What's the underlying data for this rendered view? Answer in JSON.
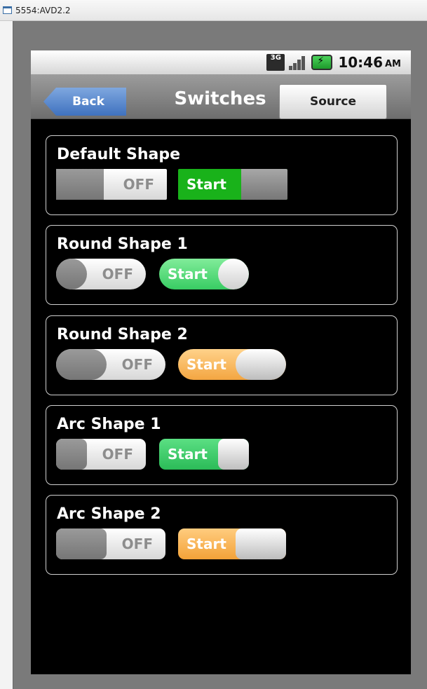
{
  "window": {
    "title": "5554:AVD2.2"
  },
  "status_bar": {
    "network": "3G",
    "time": "10:46",
    "ampm": "AM"
  },
  "nav": {
    "back_label": "Back",
    "title": "Switches",
    "source_label": "Source"
  },
  "panels": [
    {
      "title": "Default Shape",
      "off_label": "OFF",
      "on_label": "Start"
    },
    {
      "title": "Round Shape 1",
      "off_label": "OFF",
      "on_label": "Start"
    },
    {
      "title": "Round Shape 2",
      "off_label": "OFF",
      "on_label": "Start"
    },
    {
      "title": "Arc Shape 1",
      "off_label": "OFF",
      "on_label": "Start"
    },
    {
      "title": "Arc Shape 2",
      "off_label": "OFF",
      "on_label": "Start"
    }
  ],
  "colors": {
    "green_on": "#19b21a",
    "mint_on": "#38cc63",
    "orange_on": "#f3a641",
    "back_blue": "#3f72bf"
  }
}
